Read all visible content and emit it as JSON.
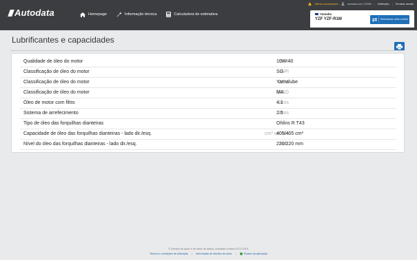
{
  "header": {
    "logo": "Autodata",
    "nav": [
      {
        "label": "Homepage",
        "icon": "home-icon"
      },
      {
        "label": "Informação técnica",
        "icon": "wrench-icon"
      },
      {
        "label": "Calculadora de estimativa",
        "icon": "calculator-icon"
      }
    ],
    "utility": {
      "updates": "Últimas actualizações",
      "user": "autodata.user 123456",
      "settings": "Definições",
      "logout": "Terminar sessão"
    },
    "vehicle": {
      "brand": "Yamaha",
      "model": "YZF YZF-R1M",
      "select_label": "Seleccionar outro veículo"
    }
  },
  "page": {
    "title": "Lubrificantes e capacidades"
  },
  "table": {
    "rows": [
      {
        "label": "Qualidade de óleo do motor",
        "unit": "SAE",
        "value": "10W-40"
      },
      {
        "label": "Classificação de óleo do motor",
        "unit": "API",
        "value": "SG"
      },
      {
        "label": "Classificação de óleo do motor",
        "unit": "OEM",
        "value": "Yamalube"
      },
      {
        "label": "Classificação de óleo do motor",
        "unit": "JASO",
        "value": "MA"
      },
      {
        "label": "Óleo de motor com filtro",
        "unit": "litros",
        "value": "4.1"
      },
      {
        "label": "Sistema de arrefecimento",
        "unit": "litros",
        "value": "2.5"
      },
      {
        "label": "Tipo de óleo das forquilhas dianteiras",
        "unit": "",
        "value": "Ohlins R T43"
      },
      {
        "label": "Capacidade de óleo das forquilhas dianteiras - lado dir./esq.",
        "unit": "cm³ ou mm",
        "value": "405/405 cm³"
      },
      {
        "label": "Nível do óleo das forquilhas dianteiras - lado dir./esq.",
        "unit": "mm.",
        "value": "220/220 mm"
      }
    ]
  },
  "footer": {
    "copyright": "© Direitos de autor e de base de dados. Autodata Limited 1972-2019.",
    "links": [
      "Termos e condições de utilização",
      "Informação de direitos de autor",
      "Estado da aplicação"
    ]
  },
  "colors": {
    "accent": "#1f6fb8",
    "header_bg": "#3b3d40",
    "status_ok": "#3aa34a"
  }
}
